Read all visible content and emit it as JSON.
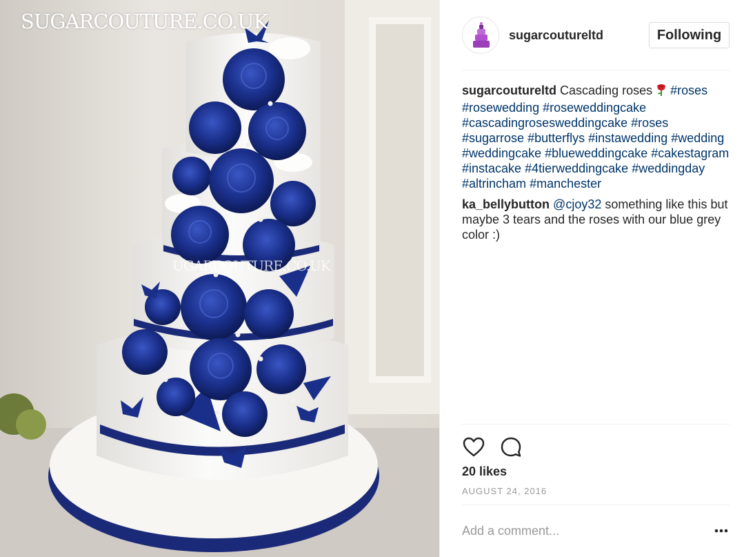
{
  "photo": {
    "watermark_top": "SUGARCOUTURE.CO.UK",
    "watermark_mid": "UGARCOUTURE.CO.UK",
    "colors": {
      "rose": "#1a2f8a",
      "icing": "#f4f3f0",
      "wall": "#dcd8d2",
      "ribbon": "#1b2a78"
    }
  },
  "post": {
    "username": "sugarcoutureltd",
    "follow_label": "Following",
    "caption": {
      "user": "sugarcoutureltd",
      "text": "Cascading roses",
      "emoji": "rose-icon",
      "hashtags": [
        "#roses",
        "#rosewedding",
        "#roseweddingcake",
        "#cascadingrosesweddingcake",
        "#roses",
        "#sugarrose",
        "#butterflys",
        "#instawedding",
        "#wedding",
        "#weddingcake",
        "#blueweddingcake",
        "#cakestagram",
        "#instacake",
        "#4tierweddingcake",
        "#weddingday",
        "#altrincham",
        "#manchester"
      ]
    },
    "comment": {
      "user": "ka_bellybutton",
      "mention": "@cjoy32",
      "text": "something like this but maybe 3 tears and the roses with our blue grey color :)"
    },
    "likes": "20 likes",
    "date": "August 24, 2016",
    "comment_placeholder": "Add a comment...",
    "icons": {
      "like": "heart-icon",
      "comment": "comment-icon",
      "more": "more-icon"
    }
  }
}
